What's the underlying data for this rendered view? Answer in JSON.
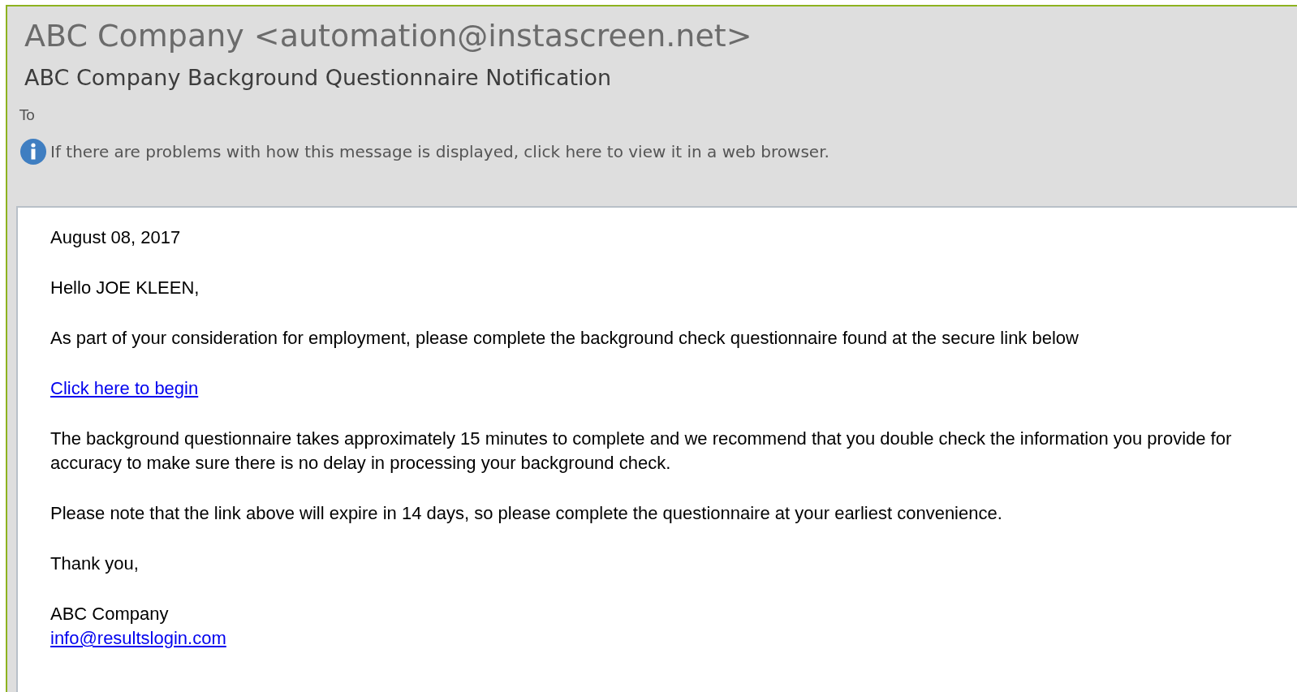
{
  "sender": "ABC Company <automation@instascreen.net>",
  "subject": "ABC Company Background Questionnaire Notification",
  "to_label": "To",
  "info_bar": "If there are problems with how this message is displayed, click here to view it in a web browser.",
  "body": [
    {
      "kind": "text",
      "text": "August 08, 2017"
    },
    {
      "kind": "text",
      "text": "Hello JOE KLEEN,"
    },
    {
      "kind": "text",
      "text": "As part of your consideration for employment, please complete the background check questionnaire found at the secure link below"
    },
    {
      "kind": "link",
      "text": "Click here to begin"
    },
    {
      "kind": "text",
      "text": "The background questionnaire takes approximately 15 minutes to complete and we recommend that you double check the information you provide for accuracy to make sure there is no delay in processing your background check."
    },
    {
      "kind": "text",
      "text": "Please note that the link above will expire in 14 days, so please complete the questionnaire at your earliest convenience."
    },
    {
      "kind": "text",
      "text": "Thank you,"
    },
    {
      "kind": "signature",
      "text": "ABC Company",
      "link": "info@resultslogin.com"
    }
  ]
}
